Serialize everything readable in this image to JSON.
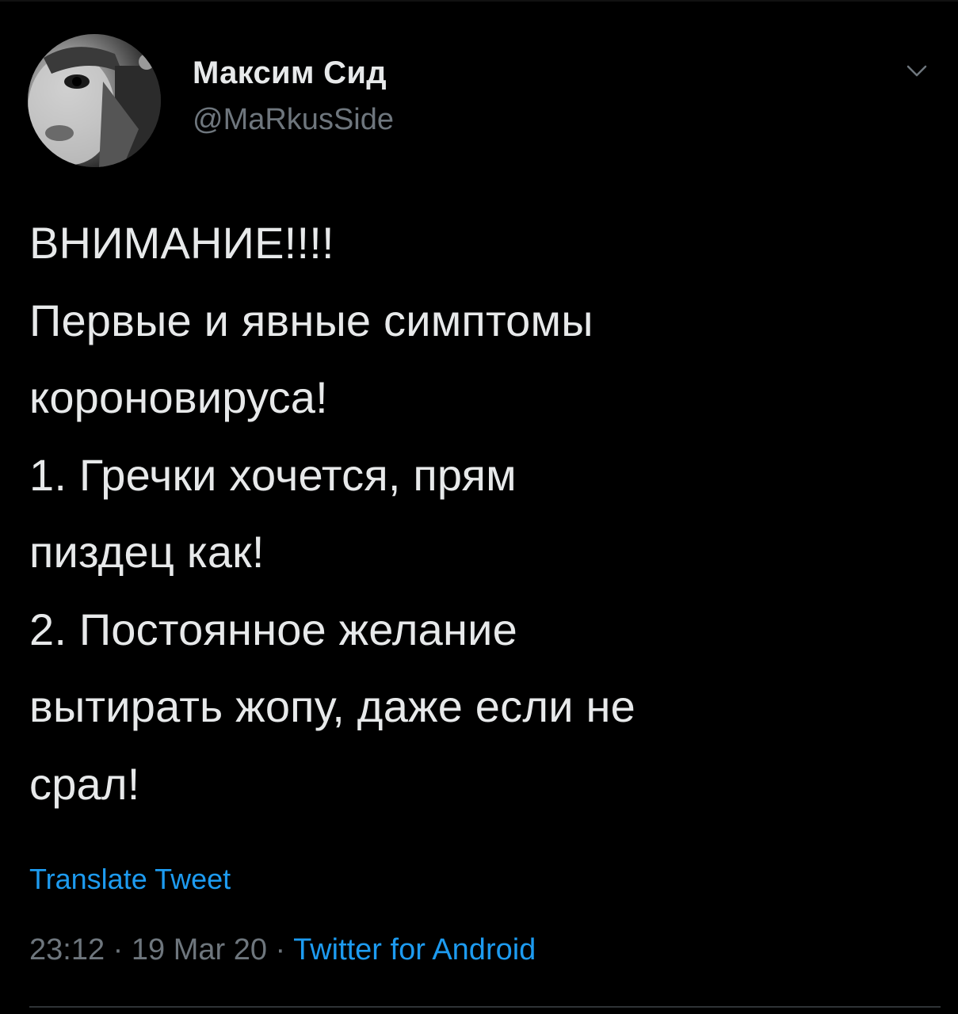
{
  "author": {
    "display_name": "Максим Сид",
    "handle": "@MaRkusSide",
    "avatar_icon": "profile-photo"
  },
  "menu": {
    "icon": "chevron-down-icon"
  },
  "tweet": {
    "lines": [
      "ВНИМАНИЕ!!!!",
      "Первые и явные симптомы",
      "короновируса!",
      "1. Гречки хочется, прям",
      "пиздец как!",
      "2. Постоянное желание",
      "вытирать жопу, даже если не",
      "срал!"
    ]
  },
  "translate_label": "Translate Tweet",
  "meta": {
    "time": "23:12",
    "separator": " · ",
    "date": "19 Mar 20",
    "source": "Twitter for Android"
  },
  "colors": {
    "background": "#000000",
    "text": "#e7e9ea",
    "secondary": "#6e767d",
    "link": "#1d9bf0"
  }
}
